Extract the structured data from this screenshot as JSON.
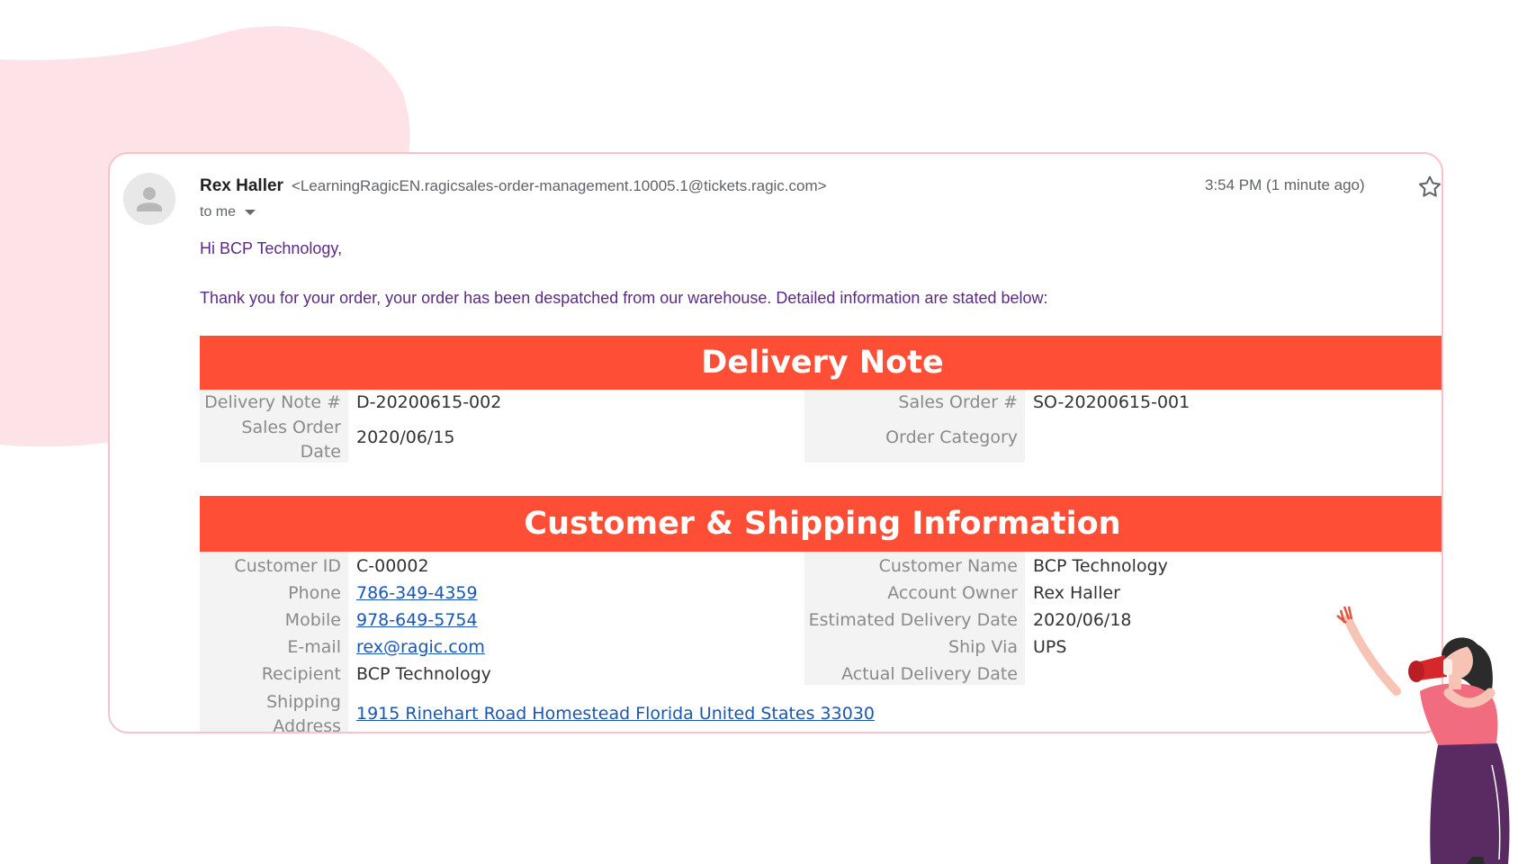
{
  "email": {
    "sender_name": "Rex Haller",
    "sender_email": "<LearningRagicEN.ragicsales-order-management.10005.1@tickets.ragic.com>",
    "to_label": "to me",
    "timestamp": "3:54 PM (1 minute ago)",
    "greeting": "Hi BCP Technology,",
    "intro": "Thank you for your order, your order has been despatched from our warehouse. Detailed information are stated below:"
  },
  "delivery_note": {
    "title": "Delivery Note",
    "fields": {
      "delivery_note_no_label": "Delivery Note #",
      "delivery_note_no": "D-20200615-002",
      "sales_order_no_label": "Sales Order #",
      "sales_order_no": "SO-20200615-001",
      "sales_order_date_label": "Sales Order Date",
      "sales_order_date": "2020/06/15",
      "order_category_label": "Order Category",
      "order_category": ""
    }
  },
  "customer_shipping": {
    "title": "Customer & Shipping Information",
    "fields": {
      "customer_id_label": "Customer ID",
      "customer_id": "C-00002",
      "phone_label": "Phone",
      "phone": "786-349-4359",
      "mobile_label": "Mobile",
      "mobile": "978-649-5754",
      "email_label": "E-mail",
      "email": "rex@ragic.com",
      "recipient_label": "Recipient",
      "recipient": "BCP Technology",
      "shipping_address_label": "Shipping Address",
      "shipping_address": "1915 Rinehart Road Homestead Florida United States 33030",
      "customer_name_label": "Customer Name",
      "customer_name": "BCP Technology",
      "account_owner_label": "Account Owner",
      "account_owner": "Rex Haller",
      "est_delivery_label": "Estimated Delivery Date",
      "est_delivery": "2020/06/18",
      "ship_via_label": "Ship Via",
      "ship_via": "UPS",
      "actual_delivery_label": "Actual Delivery Date",
      "actual_delivery": ""
    }
  },
  "colors": {
    "header_bg": "#fe4f36",
    "body_text": "#5b2a86",
    "link": "#1a56b5",
    "label_bg": "#f3f3f3",
    "card_border": "#f7c2c8",
    "blob": "#fde3e7"
  },
  "icons": [
    "avatar-icon",
    "star-icon",
    "dropdown-caret-icon"
  ]
}
